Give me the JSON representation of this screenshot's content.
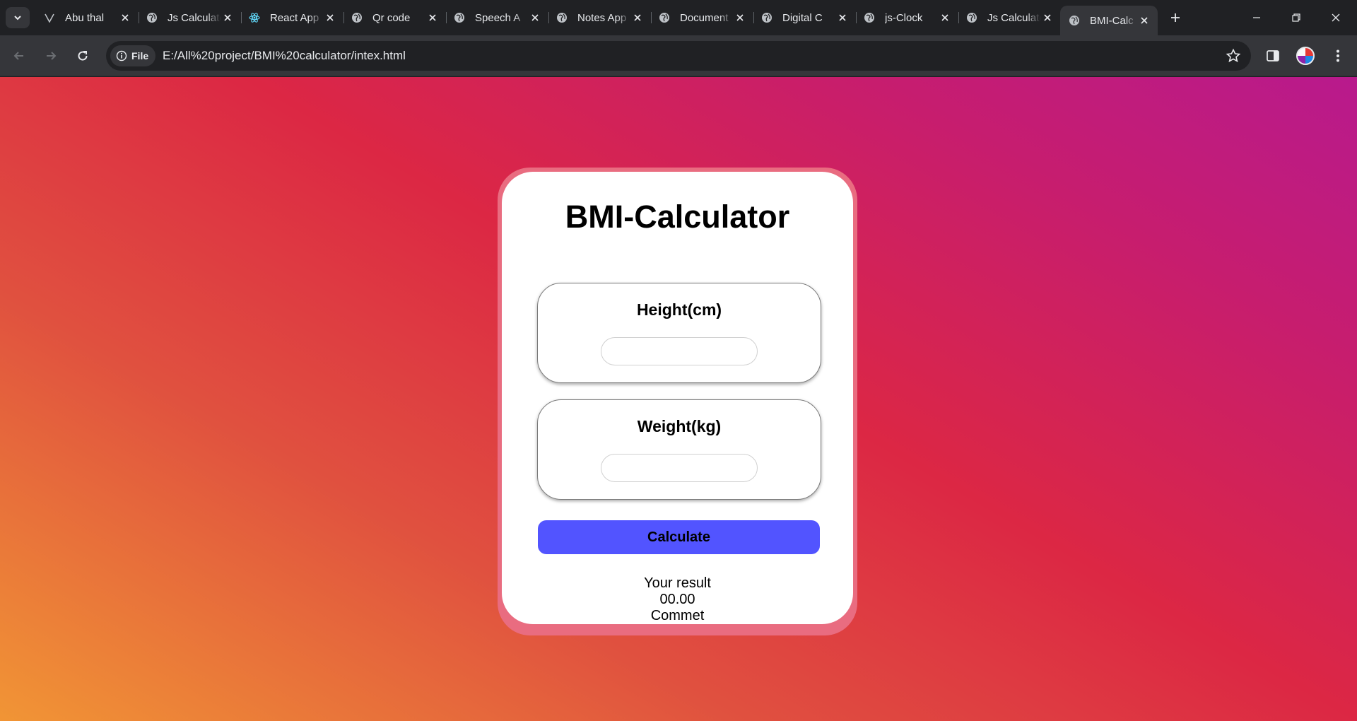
{
  "browser": {
    "tabs": [
      {
        "title": "Abu thal",
        "icon": "vercel-icon"
      },
      {
        "title": "Js Calculator",
        "icon": "globe-icon"
      },
      {
        "title": "React App",
        "icon": "react-icon"
      },
      {
        "title": "Qr code",
        "icon": "globe-icon"
      },
      {
        "title": "Speech A",
        "icon": "globe-icon"
      },
      {
        "title": "Notes App",
        "icon": "globe-icon"
      },
      {
        "title": "Document",
        "icon": "globe-icon"
      },
      {
        "title": "Digital C",
        "icon": "globe-icon"
      },
      {
        "title": "js-Clock",
        "icon": "globe-icon"
      },
      {
        "title": "Js Calculator",
        "icon": "globe-icon"
      },
      {
        "title": "BMI-Calc",
        "icon": "globe-icon",
        "active": true
      }
    ],
    "address": {
      "chip_label": "File",
      "url": "E:/All%20project/BMI%20calculator/intex.html"
    }
  },
  "app": {
    "title": "BMI-Calculator",
    "height_field": {
      "label": "Height(cm)",
      "value": ""
    },
    "weight_field": {
      "label": "Weight(kg)",
      "value": ""
    },
    "calculate_label": "Calculate",
    "result_label": "Your result",
    "result_value": "00.00",
    "comment": "Commet"
  },
  "colors": {
    "button": "#5254ff",
    "card_border": "#e96c80",
    "bg_start": "#f19535",
    "bg_end": "#b81a8d"
  }
}
